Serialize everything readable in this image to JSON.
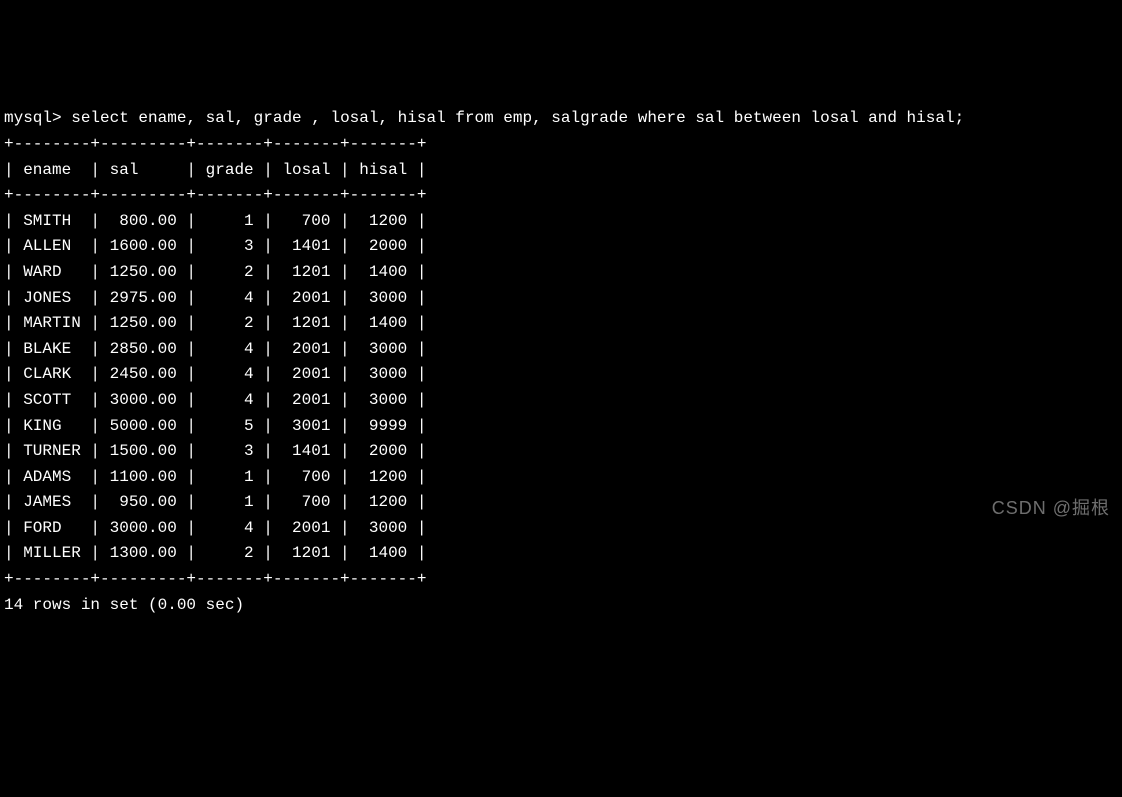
{
  "prompt": "mysql> ",
  "query": "select ename, sal, grade , losal, hisal from emp, salgrade where sal between losal and hisal;",
  "columns": [
    "ename",
    "sal",
    "grade",
    "losal",
    "hisal"
  ],
  "rows": [
    {
      "ename": "SMITH",
      "sal": "800.00",
      "grade": "1",
      "losal": "700",
      "hisal": "1200"
    },
    {
      "ename": "ALLEN",
      "sal": "1600.00",
      "grade": "3",
      "losal": "1401",
      "hisal": "2000"
    },
    {
      "ename": "WARD",
      "sal": "1250.00",
      "grade": "2",
      "losal": "1201",
      "hisal": "1400"
    },
    {
      "ename": "JONES",
      "sal": "2975.00",
      "grade": "4",
      "losal": "2001",
      "hisal": "3000"
    },
    {
      "ename": "MARTIN",
      "sal": "1250.00",
      "grade": "2",
      "losal": "1201",
      "hisal": "1400"
    },
    {
      "ename": "BLAKE",
      "sal": "2850.00",
      "grade": "4",
      "losal": "2001",
      "hisal": "3000"
    },
    {
      "ename": "CLARK",
      "sal": "2450.00",
      "grade": "4",
      "losal": "2001",
      "hisal": "3000"
    },
    {
      "ename": "SCOTT",
      "sal": "3000.00",
      "grade": "4",
      "losal": "2001",
      "hisal": "3000"
    },
    {
      "ename": "KING",
      "sal": "5000.00",
      "grade": "5",
      "losal": "3001",
      "hisal": "9999"
    },
    {
      "ename": "TURNER",
      "sal": "1500.00",
      "grade": "3",
      "losal": "1401",
      "hisal": "2000"
    },
    {
      "ename": "ADAMS",
      "sal": "1100.00",
      "grade": "1",
      "losal": "700",
      "hisal": "1200"
    },
    {
      "ename": "JAMES",
      "sal": "950.00",
      "grade": "1",
      "losal": "700",
      "hisal": "1200"
    },
    {
      "ename": "FORD",
      "sal": "3000.00",
      "grade": "4",
      "losal": "2001",
      "hisal": "3000"
    },
    {
      "ename": "MILLER",
      "sal": "1300.00",
      "grade": "2",
      "losal": "1201",
      "hisal": "1400"
    }
  ],
  "footer": "14 rows in set (0.00 sec)",
  "watermark": "CSDN @掘根",
  "colwidths": {
    "ename": 8,
    "sal": 9,
    "grade": 7,
    "losal": 7,
    "hisal": 7
  }
}
